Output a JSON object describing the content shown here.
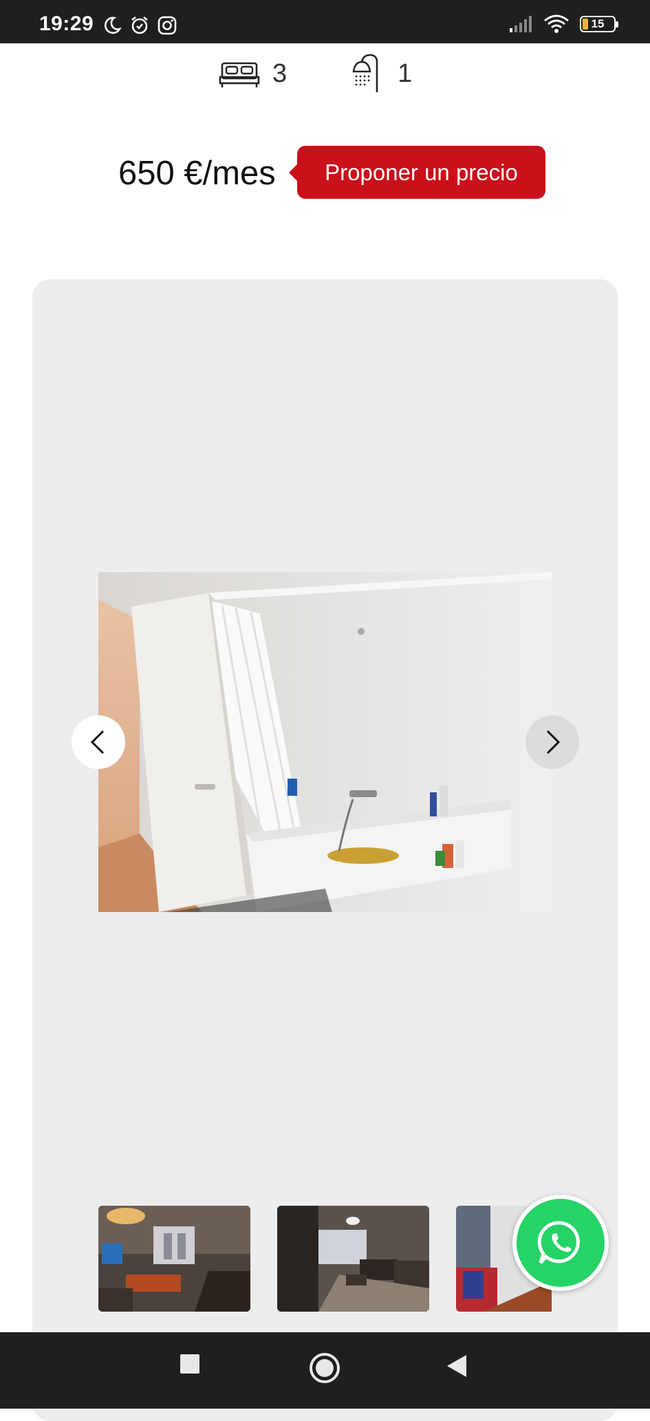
{
  "status_bar": {
    "time": "19:29",
    "battery_level": "15",
    "left_icons": [
      "moon-icon",
      "alarm-icon",
      "instagram-icon"
    ],
    "right_icons": [
      "signal-icon",
      "wifi-icon",
      "battery-icon"
    ]
  },
  "features": {
    "bedrooms": {
      "icon": "bed-icon",
      "value": "3"
    },
    "bathrooms": {
      "icon": "shower-icon",
      "value": "1"
    }
  },
  "price": {
    "amount": "650 €/mes",
    "offer_button_label": "Proponer un precio",
    "accent_color": "#c9101b"
  },
  "gallery": {
    "main_photo": "bathroom-photo",
    "prev_icon": "chevron-left-icon",
    "next_icon": "chevron-right-icon",
    "thumbnails": [
      "living-room-photo-1",
      "living-room-photo-2",
      "room-photo-3"
    ]
  },
  "whatsapp": {
    "icon": "whatsapp-icon",
    "color": "#25d366"
  },
  "nav_bar": {
    "keys": [
      "recents-square-icon",
      "home-circle-icon",
      "back-triangle-icon"
    ]
  }
}
